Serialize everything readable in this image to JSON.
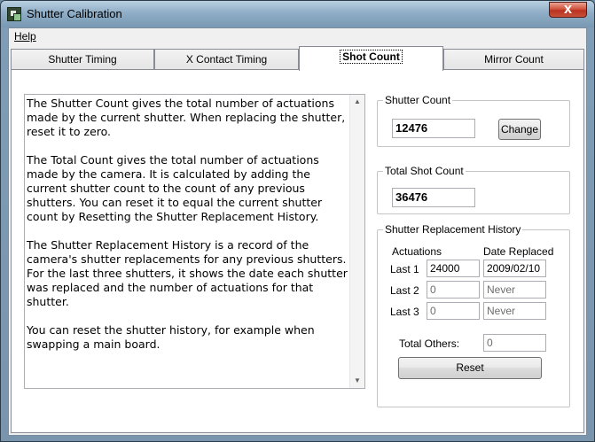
{
  "window": {
    "title": "Shutter Calibration",
    "close_glyph": "X"
  },
  "menu": {
    "help": "Help"
  },
  "tabs": [
    {
      "label": "Shutter Timing",
      "active": false
    },
    {
      "label": "X Contact Timing",
      "active": false
    },
    {
      "label": "Shot Count",
      "active": true
    },
    {
      "label": "Mirror Count",
      "active": false
    }
  ],
  "description": {
    "paragraphs": [
      "The Shutter Count gives the total number of actuations made by the current shutter. When replacing the shutter, reset it to zero.",
      "The Total Count gives the total number of actuations made by the camera. It is calculated by adding the current shutter count to the count of any previous shutters. You can reset it to equal the current shutter count by Resetting the Shutter Replacement History.",
      "The Shutter Replacement History is a record of the camera's shutter replacements for any previous shutters. For the last three shutters, it shows the date each shutter was replaced and the number of actuations for that shutter.",
      "You can reset the shutter history, for example when swapping a main board."
    ]
  },
  "shutter_count": {
    "legend": "Shutter Count",
    "value": "12476",
    "change_label": "Change"
  },
  "total_shot_count": {
    "legend": "Total Shot Count",
    "value": "36476"
  },
  "history": {
    "legend": "Shutter Replacement History",
    "col_actuations": "Actuations",
    "col_date": "Date Replaced",
    "rows": [
      {
        "label": "Last 1",
        "actuations": "24000",
        "date": "2009/02/10"
      },
      {
        "label": "Last 2",
        "actuations": "0",
        "date": "Never"
      },
      {
        "label": "Last 3",
        "actuations": "0",
        "date": "Never"
      }
    ],
    "total_others_label": "Total Others:",
    "total_others_value": "0",
    "reset_label": "Reset"
  }
}
